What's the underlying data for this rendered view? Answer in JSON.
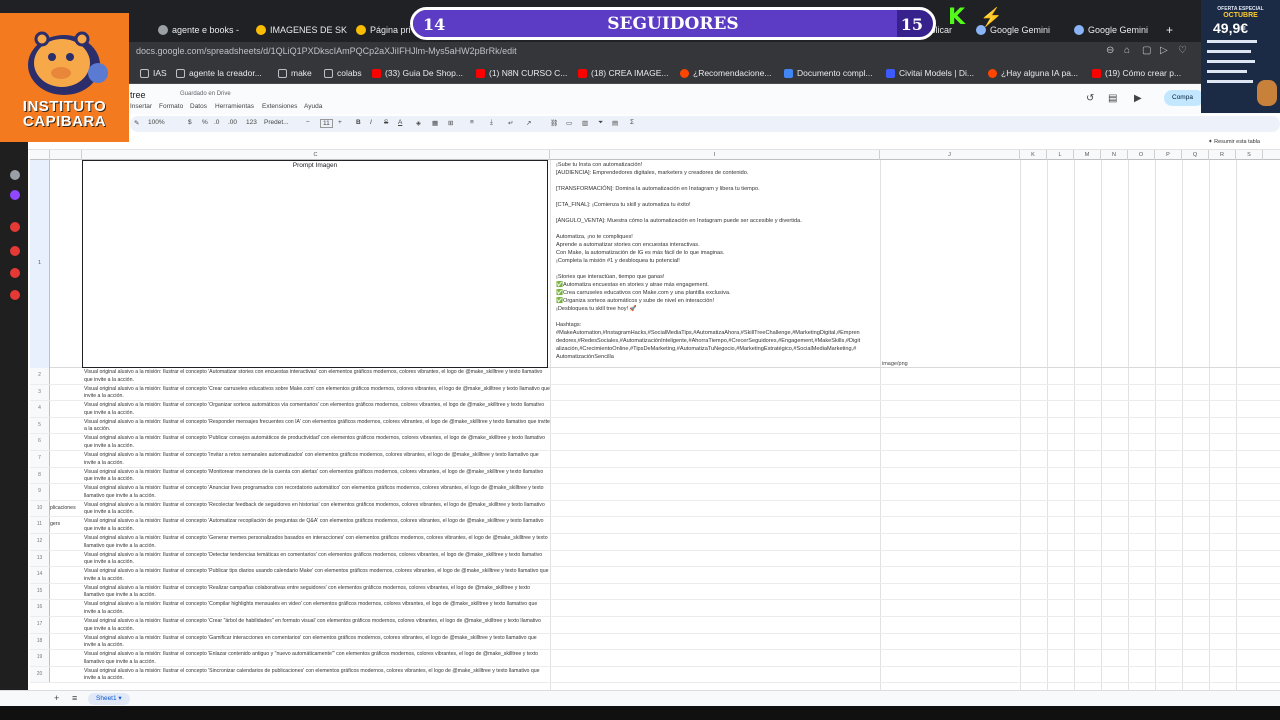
{
  "browser": {
    "tabs": [
      {
        "label": "agente e books -",
        "color": "#9aa0a6"
      },
      {
        "label": "IMAGENES DE SK",
        "color": "#fbbc04"
      },
      {
        "label": "Página pri",
        "color": "#fbbc04"
      },
      {
        "label": "ágina publicar",
        "color": "#9aa0a6"
      },
      {
        "label": "Google Gemini",
        "color": "#8ab4f8"
      },
      {
        "label": "Google Gemini",
        "color": "#8ab4f8"
      }
    ],
    "new_tab": "+",
    "url": "docs.google.com/spreadsheets/d/1QLiQ1PXDkscIAmPQCp2aXJiIFHJlm-Mys5aHW2pBrRk/edit",
    "bookmarks": [
      {
        "label": "IAS",
        "color": "#9aa0a6"
      },
      {
        "label": "agente la creador...",
        "color": "#9aa0a6"
      },
      {
        "label": "make",
        "color": "#9aa0a6"
      },
      {
        "label": "colabs",
        "color": "#9aa0a6"
      },
      {
        "label": "(33) Guia De Shop...",
        "color": "#ff0000"
      },
      {
        "label": "(1) N8N CURSO C...",
        "color": "#ff0000"
      },
      {
        "label": "(18) CREA IMAGE...",
        "color": "#ff0000"
      },
      {
        "label": "¿Recomendacione...",
        "color": "#ff4500"
      },
      {
        "label": "Documento compl...",
        "color": "#4285f4"
      },
      {
        "label": "Civitai Models | Di...",
        "color": "#3d5afe"
      },
      {
        "label": "¿Hay alguna IA pa...",
        "color": "#ff4500"
      },
      {
        "label": "(19) Cómo crear p...",
        "color": "#ff0000"
      }
    ]
  },
  "sheets": {
    "title": "tree",
    "saved_status": "Guardado en Drive",
    "menus": [
      "Insertar",
      "Formato",
      "Datos",
      "Herramientas",
      "Extensiones",
      "Ayuda"
    ],
    "toolbar": {
      "zoom": "100%",
      "font": "Predet...",
      "font_size": "11",
      "sigma": "Σ"
    },
    "share_label": "Compa",
    "summary_label": "Resumir esta tabla",
    "columns": [
      "C",
      "I",
      "J",
      "K",
      "L",
      "M",
      "N",
      "O",
      "P",
      "Q",
      "R",
      "S"
    ],
    "row1": {
      "number": "1",
      "prompt_header": "Prompt Imagen",
      "text_lines": [
        "¡Sube tu Insta con automatización!",
        "[AUDIENCIA]: Emprendedores digitales, marketers y creadores de contenido.",
        "",
        "[TRANSFORMACIÓN]: Domina la automatización en Instagram y libera tu tiempo.",
        "",
        "[CTA_FINAL]: ¡Comienza tu skill y automatiza tu éxito!",
        "",
        "[ÁNGULO_VENTA]: Muestra cómo la automatización en Instagram puede ser accesible y divertida.",
        "",
        "Automatiza, ¡no te compliques!",
        "Aprende a automatizar stories con encuestas interactivas.",
        "Con Make, la automatización de IG es más fácil de lo que imaginas.",
        "¡Completa la misión #1 y desbloquea tu potencial!",
        "",
        "¡Stories que interactúan, tiempo que ganas!",
        "✅Automatiza encuestas en stories y atrae más engagement.",
        "✅Crea carruseles educativos con Make.com y una plantilla exclusiva.",
        "✅Organiza sorteos automáticos y sube de nivel en interacción!",
        "¡Desbloquea tu skill tree hoy! 🚀",
        "",
        "Hashtags:",
        "#MakeAutomation,#InstagramHacks,#SocialMediaTips,#AutomatizaAhora,#SkillTreeChallenge,#MarketingDigital,#Empren",
        "dedores,#RedesSociales,#AutomatizaciónInteligente,#AhorraTiempo,#CrecerSeguidores,#Engagement,#MakeSkills,#Digit",
        "alización,#CrecimientoOnline,#TipsDeMarketing,#AutomatizaTuNegocio,#MarketingEstratégico,#SocialMediaMarketing,#",
        "AutomatizaciónSencilla"
      ],
      "mime": "image/png"
    },
    "rows": [
      {
        "num": "2",
        "a": "",
        "b": "Visual original alusivo a la misión: Ilustrar el concepto 'Automatizar stories con encuestas interactivas' con elementos gráficos modernos, colores vibrantes, el logo de @make_skilltree y texto llamativo que invite a la acción."
      },
      {
        "num": "3",
        "a": "",
        "b": "Visual original alusivo a la misión: Ilustrar el concepto 'Crear carruseles educativos sobre Make.com' con elementos gráficos modernos, colores vibrantes, el logo de @make_skilltree y texto llamativo que invite a la acción."
      },
      {
        "num": "4",
        "a": "",
        "b": "Visual original alusivo a la misión: Ilustrar el concepto 'Organizar sorteos automáticos vía comentarios' con elementos gráficos modernos, colores vibrantes, el logo de @make_skilltree y texto llamativo que invite a la acción."
      },
      {
        "num": "5",
        "a": "",
        "b": "Visual original alusivo a la misión: Ilustrar el concepto 'Responder mensajes frecuentes con IA' con elementos gráficos modernos, colores vibrantes, el logo de @make_skilltree y texto llamativo que invite a la acción."
      },
      {
        "num": "6",
        "a": "",
        "b": "Visual original alusivo a la misión: Ilustrar el concepto 'Publicar consejos automáticos de productividad' con elementos gráficos modernos, colores vibrantes, el logo de @make_skilltree y texto llamativo que invite a la acción."
      },
      {
        "num": "7",
        "a": "",
        "b": "Visual original alusivo a la misión: Ilustrar el concepto 'Invitar a retos semanales automatizados' con elementos gráficos modernos, colores vibrantes, el logo de @make_skilltree y texto llamativo que invite a la acción."
      },
      {
        "num": "8",
        "a": "",
        "b": "Visual original alusivo a la misión: Ilustrar el concepto 'Monitorear menciones de la cuenta con alertas' con elementos gráficos modernos, colores vibrantes, el logo de @make_skilltree y texto llamativo que invite a la acción."
      },
      {
        "num": "9",
        "a": "",
        "b": "Visual original alusivo a la misión: Ilustrar el concepto 'Anunciar lives programados con recordatorio automático' con elementos gráficos modernos, colores vibrantes, el logo de @make_skilltree y texto llamativo que invite a la acción."
      },
      {
        "num": "10",
        "a": "plicaciones",
        "b": "Visual original alusivo a la misión: Ilustrar el concepto 'Recolectar feedback de seguidores en historias' con elementos gráficos modernos, colores vibrantes, el logo de @make_skilltree y texto llamativo que invite a la acción."
      },
      {
        "num": "11",
        "a": "gers",
        "b": "Visual original alusivo a la misión: Ilustrar el concepto 'Automatizar recopilación de preguntas de Q&A' con elementos gráficos modernos, colores vibrantes, el logo de @make_skilltree y texto llamativo que invite a la acción."
      },
      {
        "num": "12",
        "a": "",
        "b": "Visual original alusivo a la misión: Ilustrar el concepto 'Generar memes personalizados basados en interacciones' con elementos gráficos modernos, colores vibrantes, el logo de @make_skilltree y texto llamativo que invite a la acción."
      },
      {
        "num": "13",
        "a": "",
        "b": "Visual original alusivo a la misión: Ilustrar el concepto 'Detectar tendencias temáticas en comentarios' con elementos gráficos modernos, colores vibrantes, el logo de @make_skilltree y texto llamativo que invite a la acción."
      },
      {
        "num": "14",
        "a": "",
        "b": "Visual original alusivo a la misión: Ilustrar el concepto 'Publicar tips diarios usando calendario Make' con elementos gráficos modernos, colores vibrantes, el logo de @make_skilltree y texto llamativo que invite a la acción."
      },
      {
        "num": "15",
        "a": "",
        "b": "Visual original alusivo a la misión: Ilustrar el concepto 'Realizar campañas colaborativas entre seguidores' con elementos gráficos modernos, colores vibrantes, el logo de @make_skilltree y texto llamativo que invite a la acción."
      },
      {
        "num": "16",
        "a": "",
        "b": "Visual original alusivo a la misión: Ilustrar el concepto 'Compilar highlights mensuales en video' con elementos gráficos modernos, colores vibrantes, el logo de @make_skilltree y texto llamativo que invite a la acción."
      },
      {
        "num": "17",
        "a": "",
        "b": "Visual original alusivo a la misión: Ilustrar el concepto 'Crear \"árbol de habilidades\" en formato visual' con elementos gráficos modernos, colores vibrantes, el logo de @make_skilltree y texto llamativo que invite a la acción."
      },
      {
        "num": "18",
        "a": "",
        "b": "Visual original alusivo a la misión: Ilustrar el concepto 'Gamificar interacciones en comentarios' con elementos gráficos modernos, colores vibrantes, el logo de @make_skilltree y texto llamativo que invite a la acción."
      },
      {
        "num": "19",
        "a": "",
        "b": "Visual original alusivo a la misión: Ilustrar el concepto 'Enlazar contenido antiguo y \"nuevo automáticamente\"' con elementos gráficos modernos, colores vibrantes, el logo de @make_skilltree y texto llamativo que invite a la acción."
      },
      {
        "num": "20",
        "a": "",
        "b": "Visual original alusivo a la misión: Ilustrar el concepto 'Sincronizar calendarios de publicaciones' con elementos gráficos modernos, colores vibrantes, el logo de @make_skilltree y texto llamativo que invite a la acción."
      }
    ],
    "sheet_tab": "Sheet1"
  },
  "overlay": {
    "logo_text_line1": "INSTITUTO",
    "logo_text_line2": "CAPIBARA",
    "followers": {
      "label": "SEGUIDORES",
      "start": "14",
      "end": "15",
      "progress": 0.93
    },
    "promo": {
      "line1": "OFERTA ESPECIAL",
      "line2": "OCTUBRE",
      "price": "49,9€"
    }
  },
  "colors": {
    "accent": "#0b57d0",
    "brand_orange": "#f47a20",
    "followers_bg": "#37228d",
    "kick_green": "#53fc18"
  }
}
